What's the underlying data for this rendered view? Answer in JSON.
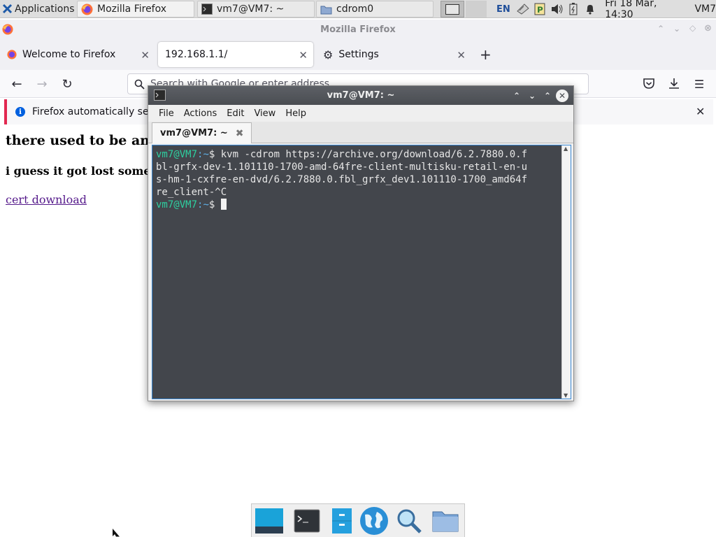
{
  "panel": {
    "applications_label": "Applications",
    "tasks": [
      {
        "label": "Mozilla Firefox"
      },
      {
        "label": "vm7@VM7: ~"
      },
      {
        "label": "cdrom0"
      }
    ],
    "keyboard_layout": "EN",
    "clock": "Fri 18 Mar, 14:30",
    "user": "VM7"
  },
  "firefox": {
    "window_title": "Mozilla Firefox",
    "tabs": [
      {
        "label": "Welcome to Firefox"
      },
      {
        "label": "192.168.1.1/"
      },
      {
        "label": "Settings"
      }
    ],
    "url_placeholder": "Search with Google or enter address",
    "notification": "Firefox automatically sends some data to Mozilla so that we can improve your experience.",
    "page": {
      "heading1": "there used to be an",
      "heading2": "i guess it got lost some",
      "link": "cert download"
    }
  },
  "terminal": {
    "title": "vm7@VM7: ~",
    "menu": [
      "File",
      "Actions",
      "Edit",
      "View",
      "Help"
    ],
    "tab_label": "vm7@VM7: ~",
    "prompt_user": "vm7@VM7",
    "prompt_path": ":~",
    "prompt_symbol": "$ ",
    "command_lines": [
      "kvm -cdrom https://archive.org/download/6.2.7880.0.f",
      "bl-grfx-dev-1.101110-1700-amd-64fre-client-multisku-retail-en-u",
      "s-hm-1-cxfre-en-dvd/6.2.7880.0.fbl_grfx_dev1.101110-1700_amd64f",
      "re_client-^C"
    ]
  },
  "colors": {
    "terminal_bg": "#43464c",
    "prompt_user": "#2ecfa0",
    "prompt_path": "#5fb2e8",
    "notification_accent": "#e22850",
    "link": "#551a8b"
  }
}
